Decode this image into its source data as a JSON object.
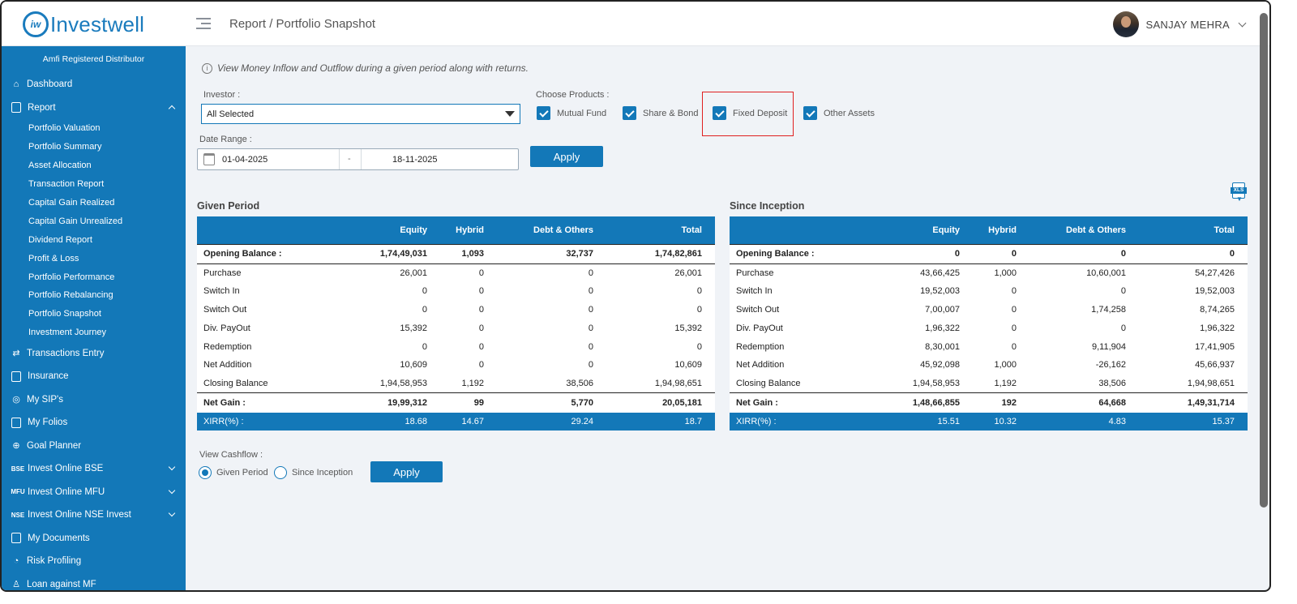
{
  "header": {
    "logo_mark": "iw",
    "logo_text": "Investwell",
    "breadcrumb": "Report / Portfolio Snapshot",
    "user_name": "SANJAY MEHRA"
  },
  "sidebar": {
    "amfi": "Amfi Registered Distributor",
    "items": [
      {
        "label": "Dashboard",
        "icon": "home-icon"
      },
      {
        "label": "Report",
        "icon": "report-icon"
      },
      {
        "label": "Transactions Entry",
        "icon": "transfer-icon"
      },
      {
        "label": "Insurance",
        "icon": "insurance-icon"
      },
      {
        "label": "My SIP's",
        "icon": "sip-icon"
      },
      {
        "label": "My Folios",
        "icon": "folios-icon"
      },
      {
        "label": "Goal Planner",
        "icon": "goal-icon"
      },
      {
        "label": "Invest Online BSE",
        "icon": "bse-icon",
        "badge": "BSE"
      },
      {
        "label": "Invest Online MFU",
        "icon": "mfu-icon",
        "badge": "MFU"
      },
      {
        "label": "Invest Online NSE Invest",
        "icon": "nse-icon",
        "badge": "NSE"
      },
      {
        "label": "My Documents",
        "icon": "documents-icon"
      },
      {
        "label": "Risk Profiling",
        "icon": "risk-icon"
      },
      {
        "label": "Loan against MF",
        "icon": "loan-icon"
      }
    ],
    "report_sub": [
      "Portfolio Valuation",
      "Portfolio Summary",
      "Asset Allocation",
      "Transaction Report",
      "Capital Gain Realized",
      "Capital Gain Unrealized",
      "Dividend Report",
      "Profit & Loss",
      "Portfolio Performance",
      "Portfolio Rebalancing",
      "Portfolio Snapshot",
      "Investment Journey"
    ]
  },
  "main": {
    "info": "View Money Inflow and Outflow during a given period along with returns.",
    "investor_label": "Investor :",
    "investor_value": "All Selected",
    "products_label": "Choose Products :",
    "products": [
      "Mutual Fund",
      "Share & Bond",
      "Fixed Deposit",
      "Other Assets"
    ],
    "date_label": "Date Range :",
    "date_from": "01-04-2025",
    "date_sep": "-",
    "date_to": "18-11-2025",
    "apply": "Apply",
    "given_title": "Given Period",
    "since_title": "Since Inception",
    "columns": [
      "",
      "Equity",
      "Hybrid",
      "Debt & Others",
      "Total"
    ],
    "given_rows": [
      [
        "Opening Balance :",
        "1,74,49,031",
        "1,093",
        "32,737",
        "1,74,82,861"
      ],
      [
        "Purchase",
        "26,001",
        "0",
        "0",
        "26,001"
      ],
      [
        "Switch In",
        "0",
        "0",
        "0",
        "0"
      ],
      [
        "Switch Out",
        "0",
        "0",
        "0",
        "0"
      ],
      [
        "Div. PayOut",
        "15,392",
        "0",
        "0",
        "15,392"
      ],
      [
        "Redemption",
        "0",
        "0",
        "0",
        "0"
      ],
      [
        "Net Addition",
        "10,609",
        "0",
        "0",
        "10,609"
      ],
      [
        "Closing Balance",
        "1,94,58,953",
        "1,192",
        "38,506",
        "1,94,98,651"
      ],
      [
        "Net Gain :",
        "19,99,312",
        "99",
        "5,770",
        "20,05,181"
      ],
      [
        "XIRR(%) :",
        "18.68",
        "14.67",
        "29.24",
        "18.7"
      ]
    ],
    "since_rows": [
      [
        "Opening Balance :",
        "0",
        "0",
        "0",
        "0"
      ],
      [
        "Purchase",
        "43,66,425",
        "1,000",
        "10,60,001",
        "54,27,426"
      ],
      [
        "Switch In",
        "19,52,003",
        "0",
        "0",
        "19,52,003"
      ],
      [
        "Switch Out",
        "7,00,007",
        "0",
        "1,74,258",
        "8,74,265"
      ],
      [
        "Div. PayOut",
        "1,96,322",
        "0",
        "0",
        "1,96,322"
      ],
      [
        "Redemption",
        "8,30,001",
        "0",
        "9,11,904",
        "17,41,905"
      ],
      [
        "Net Addition",
        "45,92,098",
        "1,000",
        "-26,162",
        "45,66,937"
      ],
      [
        "Closing Balance",
        "1,94,58,953",
        "1,192",
        "38,506",
        "1,94,98,651"
      ],
      [
        "Net Gain :",
        "1,48,66,855",
        "192",
        "64,668",
        "1,49,31,714"
      ],
      [
        "XIRR(%) :",
        "15.51",
        "10.32",
        "4.83",
        "15.37"
      ]
    ],
    "cashflow_label": "View Cashflow :",
    "cashflow_options": [
      "Given Period",
      "Since Inception"
    ],
    "xls_label": "XLS"
  },
  "colors": {
    "accent": "#1378b8",
    "highlight": "#e02020"
  }
}
